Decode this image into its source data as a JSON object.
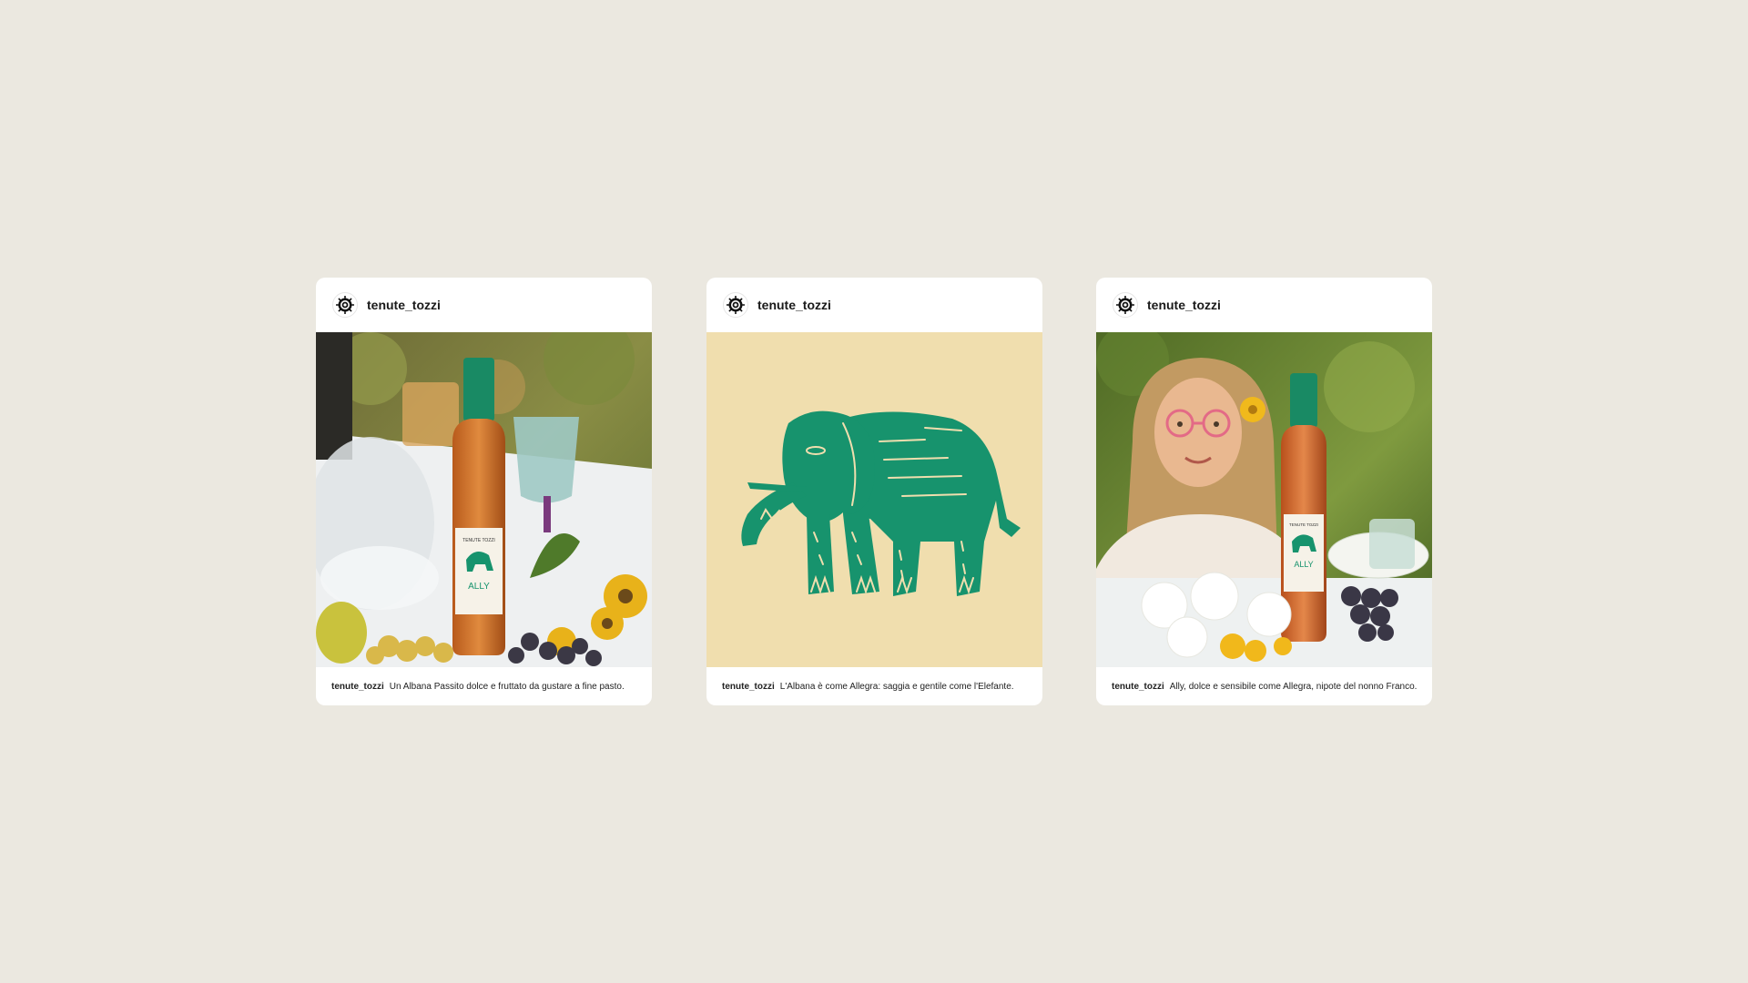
{
  "posts": [
    {
      "username": "tenute_tozzi",
      "caption_user": "tenute_tozzi",
      "caption_text": "Un Albana Passito dolce e fruttato da gustare a fine pasto.",
      "label_brand": "TENUTE TOZZI",
      "label_name": "ALLY"
    },
    {
      "username": "tenute_tozzi",
      "caption_user": "tenute_tozzi",
      "caption_text": "L'Albana è come Allegra: saggia e gentile come l'Elefante."
    },
    {
      "username": "tenute_tozzi",
      "caption_user": "tenute_tozzi",
      "caption_text": "Ally, dolce e sensibile come Allegra, nipote del nonno Franco.",
      "label_brand": "TENUTE TOZZI",
      "label_name": "ALLY"
    }
  ],
  "colors": {
    "background": "#ebe8e0",
    "card": "#ffffff",
    "elephant_green": "#17936d",
    "illustration_bg": "#f0deae",
    "wine_amber": "#c9702a"
  },
  "icons": {
    "avatar": "sun-logo-icon"
  }
}
